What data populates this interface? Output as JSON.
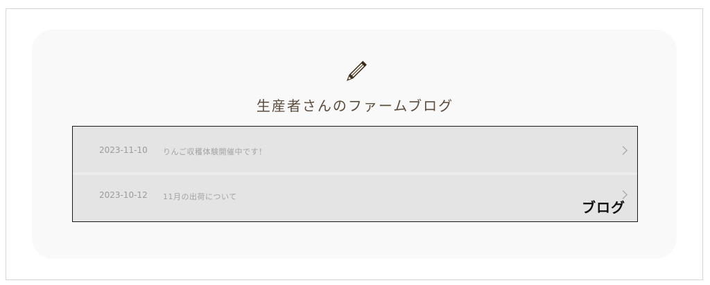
{
  "section": {
    "icon": "pencil-icon",
    "title": "生産者さんのファームブログ"
  },
  "posts": [
    {
      "date": "2023-11-10",
      "title": "りんご収穫体験開催中です！"
    },
    {
      "date": "2023-10-12",
      "title": "11月の出荷について"
    }
  ],
  "overlay": {
    "blog_label": "ブログ"
  },
  "colors": {
    "card_bg": "#f9f9f9",
    "list_bg": "#e4e4e4",
    "title_text": "#5c4a3a",
    "icon": "#3b2a1a"
  }
}
